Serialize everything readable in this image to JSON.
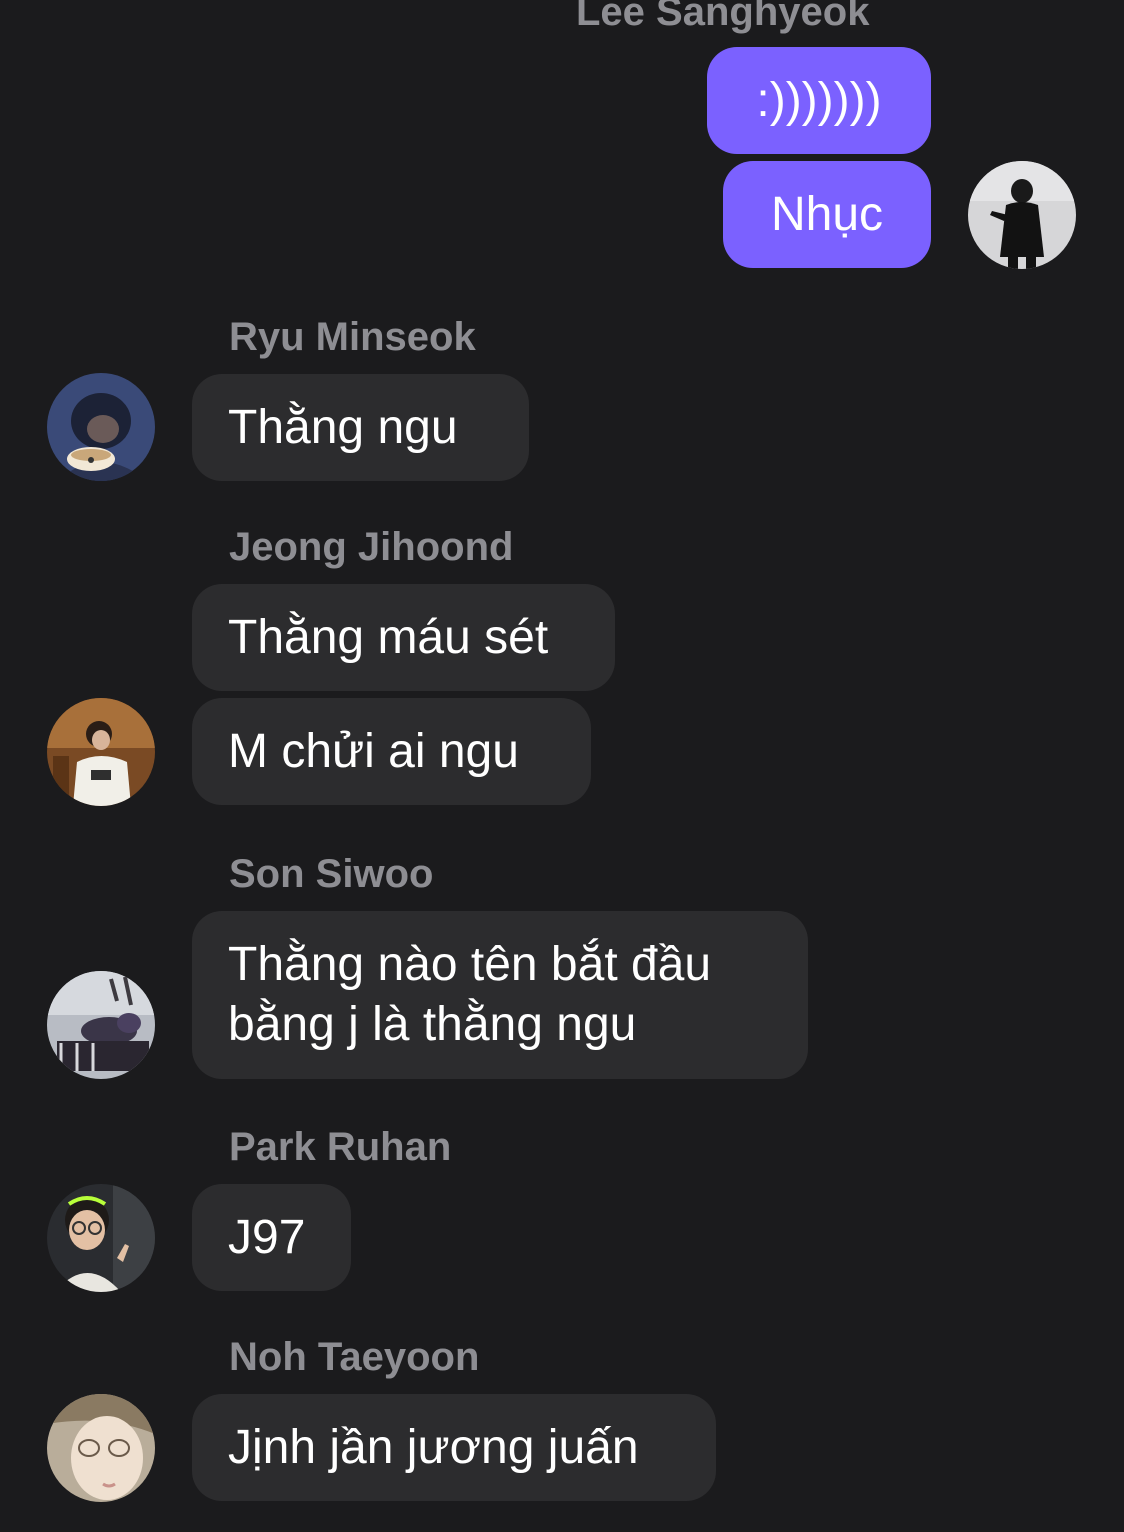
{
  "colors": {
    "background": "#1b1b1d",
    "incoming_bubble": "#2c2c2e",
    "outgoing_bubble": "#7b61ff",
    "sender_name": "#8e8e93"
  },
  "messages": {
    "outgoing": {
      "sender": "Lee Sanghyeok",
      "avatar_icon": "profile-photo-icon",
      "items": [
        ":)))))))",
        "Nhục"
      ]
    },
    "ryu": {
      "sender": "Ryu Minseok",
      "avatar_icon": "profile-photo-icon",
      "items": [
        "Thằng ngu"
      ]
    },
    "jeong": {
      "sender": "Jeong Jihoond",
      "avatar_icon": "profile-photo-icon",
      "items": [
        "Thằng máu sét",
        "M chửi ai ngu"
      ]
    },
    "son": {
      "sender": "Son Siwoo",
      "avatar_icon": "profile-photo-icon",
      "items": [
        "Thằng nào tên bắt đầu bằng j là thằng ngu"
      ]
    },
    "park": {
      "sender": "Park Ruhan",
      "avatar_icon": "profile-photo-icon",
      "items": [
        "J97"
      ]
    },
    "noh": {
      "sender": "Noh Taeyoon",
      "avatar_icon": "profile-photo-icon",
      "items": [
        "Jịnh jần jương juấn"
      ]
    }
  }
}
